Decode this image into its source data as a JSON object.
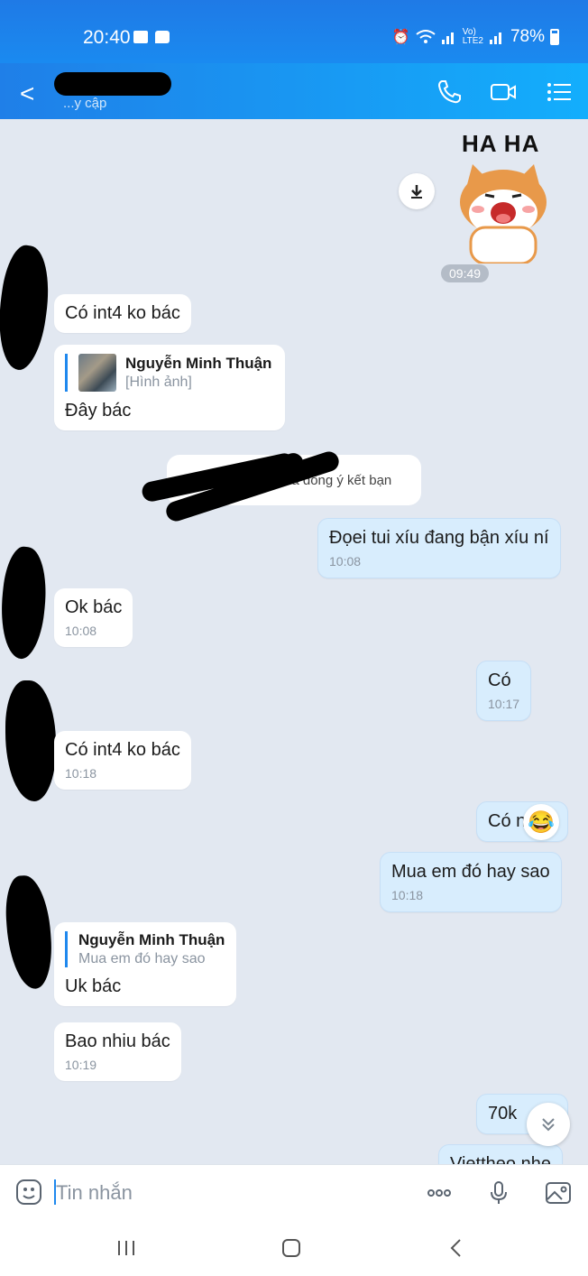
{
  "status_bar": {
    "time": "20:40",
    "battery": "78%"
  },
  "header": {
    "contact_subtitle": "...y cập"
  },
  "messages": [
    {
      "text": "Có int4 ko bác"
    },
    {
      "quote_name": "Nguyễn Minh Thuận",
      "quote_text": "[Hình ảnh]",
      "text": "Đây bác"
    },
    {
      "system_text": "đã đồng ý kết bạn"
    },
    {
      "text": "Đọei tui xíu đang bận xíu ní",
      "time": "10:08"
    },
    {
      "text": "Ok bác",
      "time": "10:08"
    },
    {
      "text": "Có",
      "time": "10:17"
    },
    {
      "text": "Có int4 ko bác",
      "time": "10:18"
    },
    {
      "text": "Có n"
    },
    {
      "text": "Mua em đó hay sao",
      "time": "10:18"
    },
    {
      "quote_name": "Nguyễn Minh Thuận",
      "quote_text": "Mua em đó hay sao",
      "text": "Uk bác"
    },
    {
      "text": "Bao nhiu bác",
      "time": "10:19"
    },
    {
      "text": "70k"
    },
    {
      "text": "Viettheo nhe"
    }
  ],
  "sticker": {
    "caption": "HA HA",
    "time": "09:49"
  },
  "input": {
    "placeholder": "Tin nhắn"
  },
  "icons": {
    "back": "arrow-left-icon",
    "call": "phone-icon",
    "video": "video-icon",
    "menu": "list-icon",
    "download": "download-icon",
    "sticker": "sticker-icon",
    "more": "more-icon",
    "mic": "microphone-icon",
    "image": "image-icon",
    "reaction": "laughing-emoji-icon"
  },
  "colors": {
    "header_blue": "#1f88ee",
    "outgoing_bubble": "#d8edfd",
    "incoming_bubble": "#ffffff",
    "chat_bg": "#e2e8f1"
  }
}
